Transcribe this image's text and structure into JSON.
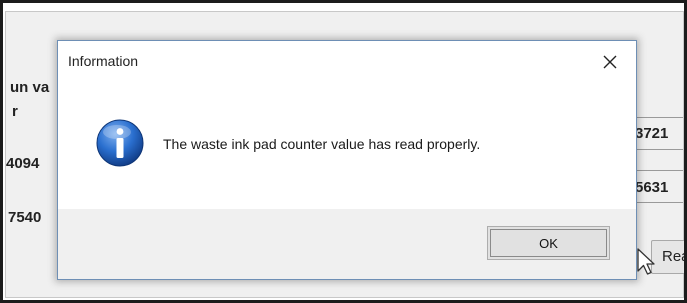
{
  "background": {
    "left_labels": [
      "un va",
      "r",
      "4094",
      "7540"
    ],
    "right_values": [
      "3721",
      "5631"
    ],
    "read_button_label": "Rea"
  },
  "dialog": {
    "title": "Information",
    "close_glyph": "×",
    "icon": "info-icon",
    "message": "The waste ink pad counter value has read properly.",
    "ok_label": "OK"
  },
  "colors": {
    "icon_blue": "#1f5fb8",
    "footer_bg": "#f0f0f0",
    "dialog_border": "#6e8fb5"
  }
}
